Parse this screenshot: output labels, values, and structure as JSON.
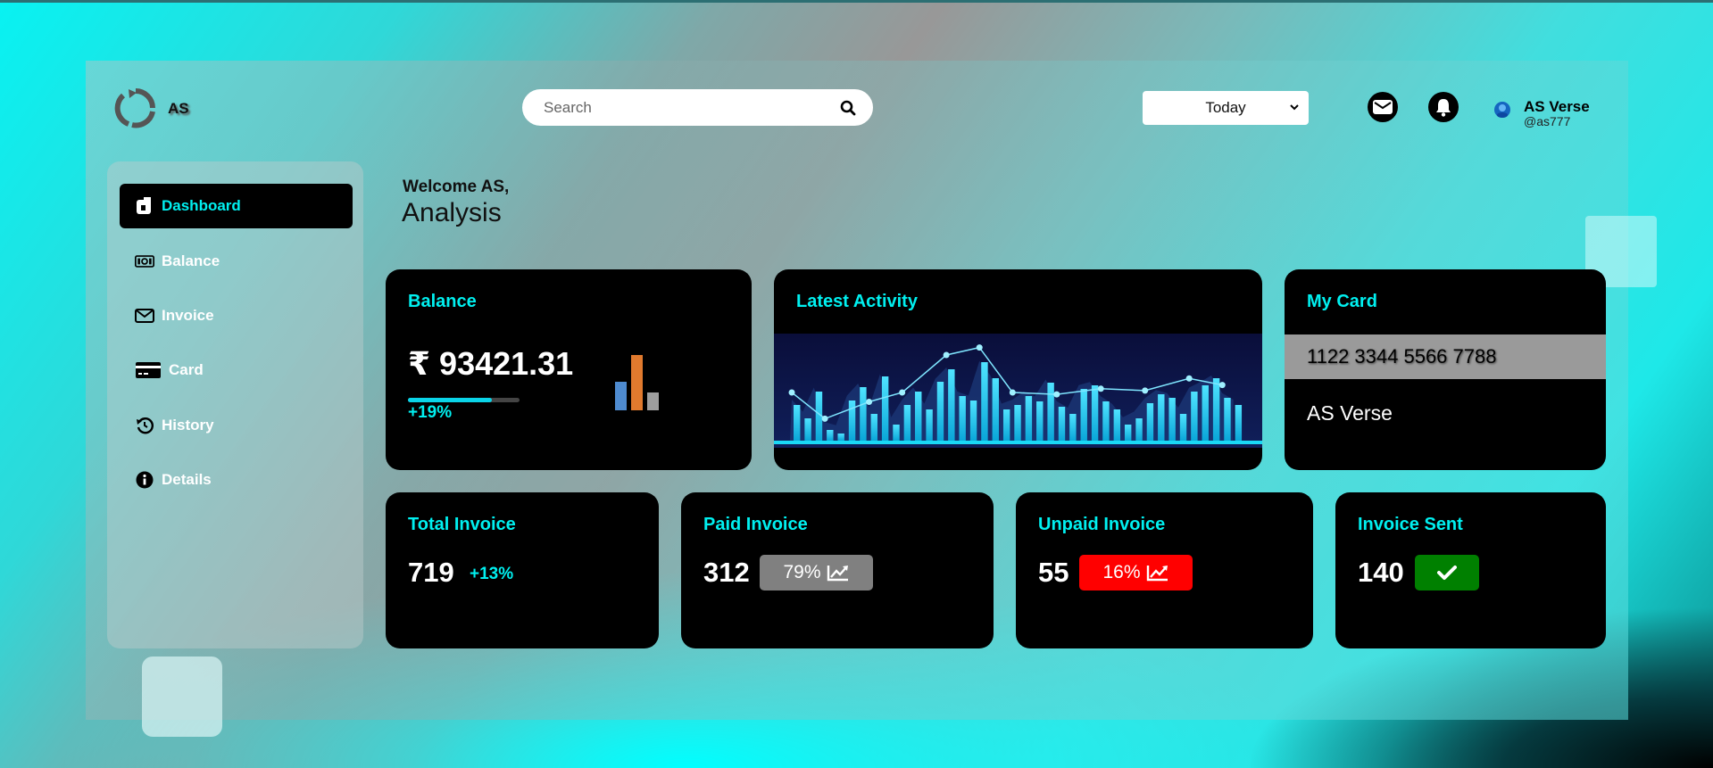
{
  "brand": {
    "name": "AS"
  },
  "search": {
    "placeholder": "Search"
  },
  "period_select": {
    "selected": "Today"
  },
  "user": {
    "name": "AS Verse",
    "handle": "@as777"
  },
  "sidebar": {
    "items": [
      {
        "label": "Dashboard",
        "icon": "dashboard-icon",
        "active": true
      },
      {
        "label": "Balance",
        "icon": "money-icon"
      },
      {
        "label": "Invoice",
        "icon": "envelope-icon"
      },
      {
        "label": "Card",
        "icon": "credit-card-icon"
      },
      {
        "label": "History",
        "icon": "history-icon"
      },
      {
        "label": "Details",
        "icon": "info-icon"
      }
    ]
  },
  "welcome": {
    "greeting": "Welcome AS,",
    "title": "Analysis"
  },
  "cards": {
    "balance": {
      "title": "Balance",
      "value": "₹ 93421.31",
      "change": "+19%",
      "progress": 0.75
    },
    "activity": {
      "title": "Latest Activity"
    },
    "my_card": {
      "title": "My Card",
      "number": "1122 3344 5566 7788",
      "holder": "AS Verse"
    },
    "total_invoice": {
      "title": "Total Invoice",
      "value": "719",
      "change": "+13%"
    },
    "paid_invoice": {
      "title": "Paid Invoice",
      "value": "312",
      "badge": "79%",
      "badge_color": "#808080"
    },
    "unpaid_invoice": {
      "title": "Unpaid Invoice",
      "value": "55",
      "badge": "16%",
      "badge_color": "#ff0000"
    },
    "invoice_sent": {
      "title": "Invoice Sent",
      "value": "140",
      "badge_color": "#008000"
    }
  },
  "colors": {
    "accent": "#00f0f0",
    "card_bg": "#000000"
  }
}
